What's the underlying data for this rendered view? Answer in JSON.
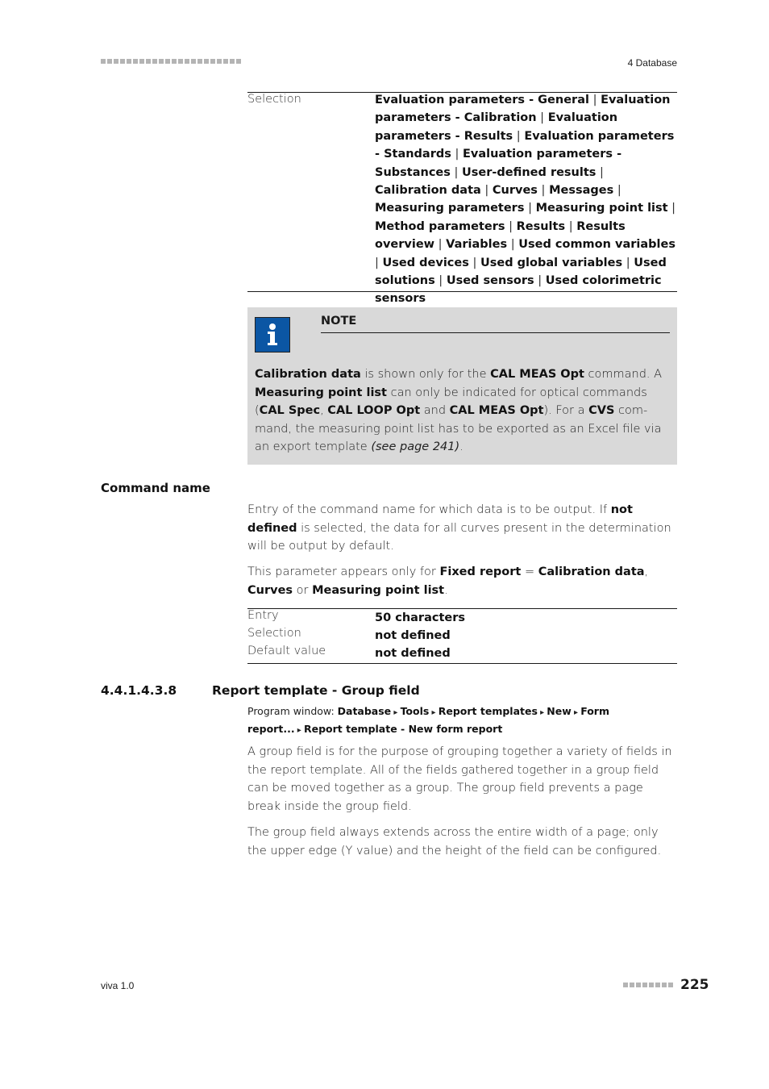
{
  "header": {
    "chapter": "4 Database",
    "marker_squares": 22
  },
  "selection_table": {
    "label": "Selection",
    "options": [
      "Evaluation parameters - General",
      "Evaluation parameters - Calibration",
      "Evaluation parameters - Results",
      "Evaluation parameters - Standards",
      "Evaluation parameters - Substances",
      "User-defined results",
      "Calibration data",
      "Curves",
      "Messages",
      "Measuring parameters",
      "Measuring point list",
      "Method parameters",
      "Results",
      "Results overview",
      "Variables",
      "Used common variables",
      "Used devices",
      "Used global variables",
      "Used solutions",
      "Used sensors",
      "Used colorimetric sensors"
    ]
  },
  "note": {
    "icon": "info-icon",
    "title": "NOTE",
    "parts": [
      {
        "b": "Calibration data"
      },
      {
        "t": " is shown only for the "
      },
      {
        "b": "CAL MEAS Opt"
      },
      {
        "t": " command. A "
      },
      {
        "b": "Measuring point list"
      },
      {
        "t": " can only be indicated for optical commands ("
      },
      {
        "b": "CAL Spec"
      },
      {
        "t": ", "
      },
      {
        "b": "CAL LOOP Opt"
      },
      {
        "t": " and "
      },
      {
        "b": "CAL MEAS Opt"
      },
      {
        "t": "). For a "
      },
      {
        "b": "CVS"
      },
      {
        "t": " com­mand, the measuring point list has to be exported as an Excel file via an export template "
      },
      {
        "i": "(see page 241)"
      },
      {
        "t": "."
      }
    ]
  },
  "command_name": {
    "heading": "Command name",
    "para1": [
      {
        "t": "Entry of the command name for which data is to be output. If "
      },
      {
        "b": "not defined"
      },
      {
        "t": " is selected, the data for all curves present in the determination will be output by default."
      }
    ],
    "para2": [
      {
        "t": "This parameter appears only for "
      },
      {
        "b": "Fixed report"
      },
      {
        "t": " = "
      },
      {
        "b": "Calibration data"
      },
      {
        "t": ", "
      },
      {
        "b": "Curves"
      },
      {
        "t": " or "
      },
      {
        "b": "Measuring point list"
      },
      {
        "t": "."
      }
    ],
    "table": [
      {
        "label": "Entry",
        "value": "50 characters"
      },
      {
        "label": "Selection",
        "value": "not defined"
      },
      {
        "label": "Default value",
        "value": "not defined"
      }
    ]
  },
  "section": {
    "number": "4.4.1.4.3.8",
    "title": "Report template - Group field",
    "program_window_label": "Program window:",
    "path": [
      "Database",
      "Tools",
      "Report templates",
      "New",
      "Form report...",
      "Report template - New form report"
    ],
    "para1": "A group field is for the purpose of grouping together a variety of fields in the report template. All of the fields gathered together in a group field can be moved together as a group. The group field prevents a page break inside the group field.",
    "para2": "The group field always extends across the entire width of a page; only the upper edge (Y value) and the height of the field can be configured."
  },
  "footer": {
    "product": "viva 1.0",
    "page_number": "225",
    "marker_squares": 8
  }
}
